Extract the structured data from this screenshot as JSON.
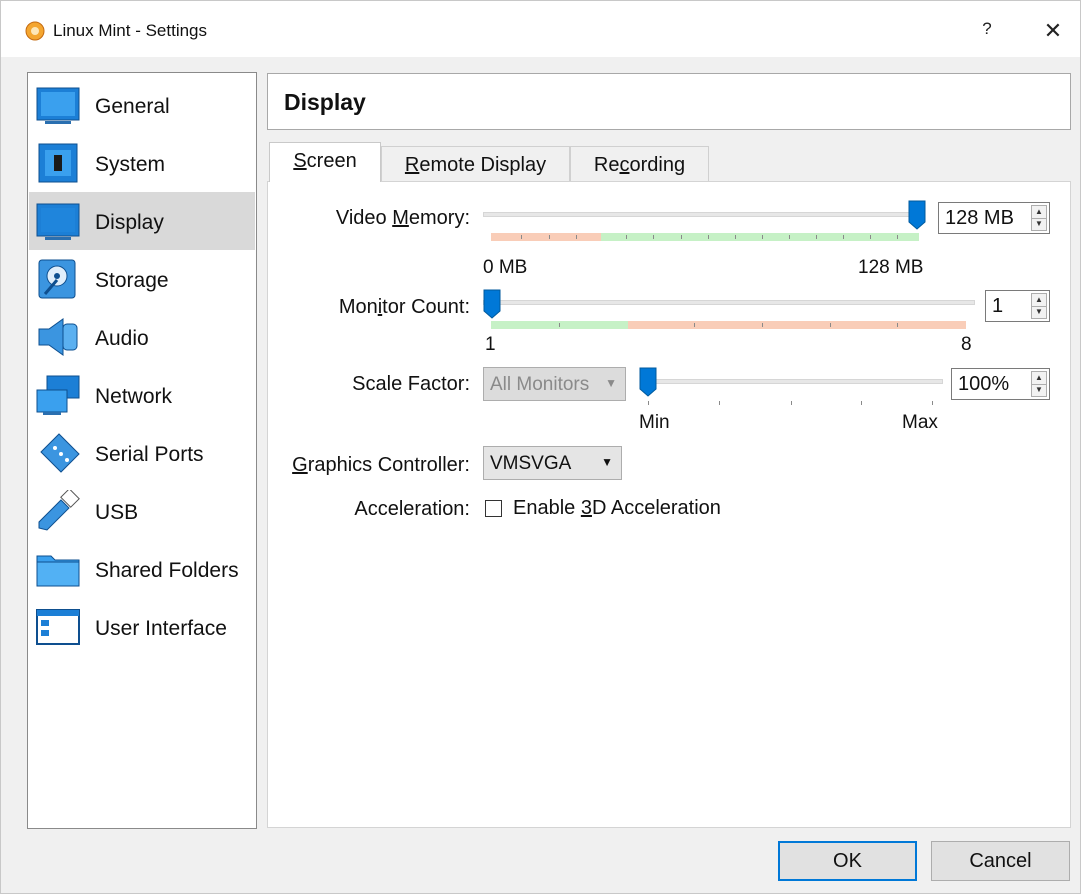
{
  "window": {
    "title": "Linux Mint - Settings",
    "help_label": "?",
    "close_label": "✕"
  },
  "sidebar": {
    "items": [
      {
        "label": "General",
        "icon": "general-icon"
      },
      {
        "label": "System",
        "icon": "system-icon"
      },
      {
        "label": "Display",
        "icon": "display-icon",
        "selected": true
      },
      {
        "label": "Storage",
        "icon": "storage-icon"
      },
      {
        "label": "Audio",
        "icon": "audio-icon"
      },
      {
        "label": "Network",
        "icon": "network-icon"
      },
      {
        "label": "Serial Ports",
        "icon": "serial-ports-icon"
      },
      {
        "label": "USB",
        "icon": "usb-icon"
      },
      {
        "label": "Shared Folders",
        "icon": "shared-folders-icon"
      },
      {
        "label": "User Interface",
        "icon": "user-interface-icon"
      }
    ]
  },
  "header": {
    "title": "Display"
  },
  "tabs": [
    {
      "label": "Screen",
      "mnemonic": "S",
      "rest": "creen",
      "active": true
    },
    {
      "label": "Remote Display",
      "pre": "",
      "mnemonic": "R",
      "rest": "emote Display"
    },
    {
      "label": "Recording",
      "pre": "Re",
      "mnemonic": "c",
      "rest": "ording"
    }
  ],
  "screen": {
    "video_memory": {
      "label_pre": "Video ",
      "label_mnemonic": "M",
      "label_rest": "emory:",
      "value": "128 MB",
      "min_label": "0 MB",
      "max_label": "128 MB",
      "level_fraction": 1.0
    },
    "monitor_count": {
      "label_pre": "Mon",
      "label_mnemonic": "i",
      "label_rest": "tor Count:",
      "value": "1",
      "min_label": "1",
      "max_label": "8",
      "level_fraction": 0.0
    },
    "scale_factor": {
      "label": "Scale Factor:",
      "monitor_select": "All Monitors",
      "value": "100%",
      "min_label": "Min",
      "max_label": "Max",
      "level_fraction": 0.0
    },
    "graphics_controller": {
      "label_pre": "",
      "label_mnemonic": "G",
      "label_rest": "raphics Controller:",
      "value": "VMSVGA"
    },
    "acceleration": {
      "label": "Acceleration:",
      "checkbox_pre": "Enable ",
      "checkbox_mnemonic": "3",
      "checkbox_rest": "D Acceleration",
      "checked": false
    }
  },
  "buttons": {
    "ok": "OK",
    "cancel": "Cancel"
  },
  "colors": {
    "accent": "#0078d7",
    "range_ok": "#c6f1c6",
    "range_warn": "#f9cdb8",
    "selected_bg": "#d9d9d9"
  }
}
